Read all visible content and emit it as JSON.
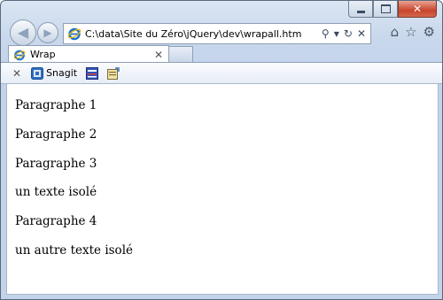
{
  "browser": {
    "address": "C:\\data\\Site du Zéro\\jQuery\\dev\\wrapall.htm",
    "tab_title": "Wrap",
    "command_bar": {
      "snagit_label": "Snagit"
    }
  },
  "page": {
    "lines": [
      "Paragraphe 1",
      "Paragraphe 2",
      "Paragraphe 3",
      "un texte isolé",
      "Paragraphe 4",
      "un autre texte isolé"
    ]
  }
}
